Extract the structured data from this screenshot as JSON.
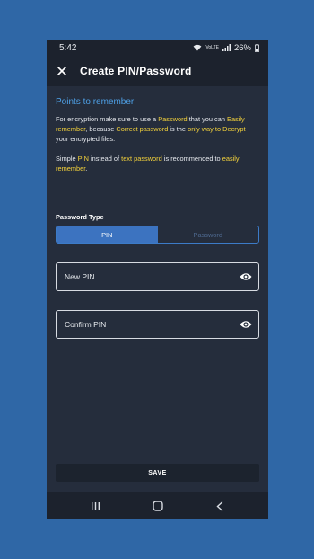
{
  "colors": {
    "page_bg": "#2f67a6",
    "accent": "#4ea0e6",
    "highlight": "#f5d33b",
    "segment_active": "#3c73c0"
  },
  "status_bar": {
    "time": "5:42",
    "network": "VoLTE",
    "battery": "26%"
  },
  "app_bar": {
    "title": "Create PIN/Password",
    "close_icon": "close-icon"
  },
  "notes": {
    "title": "Points to remember",
    "para1": {
      "t1": "For encryption make sure to use a ",
      "h1": "Password",
      "t2": " that you can ",
      "h2": "Easily remember",
      "t3": ", because ",
      "h3": "Correct password",
      "t4": " is the ",
      "h4": "only way to Decrypt",
      "t5": " your encrypted files."
    },
    "para2": {
      "t1": "Simple ",
      "h1": "PIN",
      "t2": " instead of ",
      "h2": "text password",
      "t3": " is recommended to ",
      "h3": "easily remember",
      "t4": "."
    }
  },
  "password_type": {
    "label": "Password Type",
    "options": [
      "PIN",
      "Password"
    ],
    "selected": "PIN"
  },
  "fields": {
    "new_pin": {
      "placeholder": "New PIN",
      "icon": "eye-icon"
    },
    "confirm_pin": {
      "placeholder": "Confirm PIN",
      "icon": "eye-icon"
    }
  },
  "save_label": "SAVE",
  "nav_bar": [
    "recents-icon",
    "home-icon",
    "back-icon"
  ]
}
